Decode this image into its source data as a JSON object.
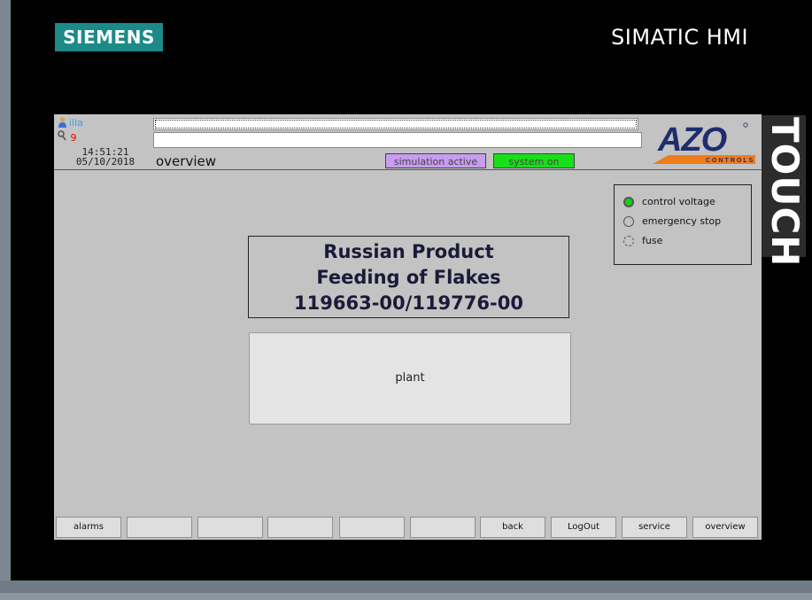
{
  "panel": {
    "brand": "SIEMENS",
    "model": "SIMATIC HMI",
    "side_label": "TOUCH"
  },
  "header": {
    "user": "illa",
    "user_level": "9",
    "time": "14:51:21",
    "date": "05/10/2018",
    "screen_title": "overview",
    "simulation_badge": "simulation active",
    "system_badge": "system on",
    "logo_name": "AZO",
    "logo_tagline": "CONTROLS"
  },
  "status": {
    "items": [
      {
        "label": "control voltage",
        "state": "on",
        "color": "#12d012"
      },
      {
        "label": "emergency stop",
        "state": "off"
      },
      {
        "label": "fuse",
        "state": "off"
      }
    ]
  },
  "project": {
    "line1": "Russian Product",
    "line2": "Feeding of Flakes",
    "line3": "119663-00/119776-00"
  },
  "main": {
    "plant_button": "plant"
  },
  "footer": {
    "keys": [
      "alarms",
      "",
      "",
      "",
      "",
      "",
      "back",
      "LogOut",
      "service",
      "overview"
    ]
  },
  "colors": {
    "siemens_teal": "#1c8b87",
    "azo_orange": "#f07d1a",
    "azo_blue": "#1e2d6e",
    "simulation_badge": "#c89cf0",
    "system_badge": "#18e018"
  }
}
